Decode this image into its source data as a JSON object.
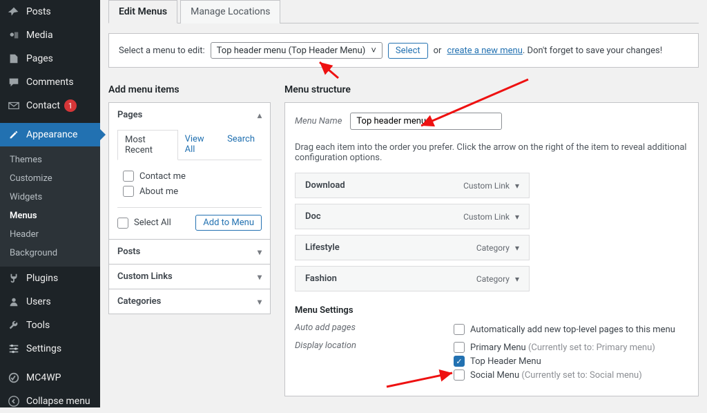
{
  "sidebar": {
    "items": [
      {
        "icon": "pin",
        "label": "Posts"
      },
      {
        "icon": "media",
        "label": "Media"
      },
      {
        "icon": "pages",
        "label": "Pages"
      },
      {
        "icon": "comments",
        "label": "Comments"
      },
      {
        "icon": "mail",
        "label": "Contact",
        "badge": "1"
      },
      {
        "icon": "brush",
        "label": "Appearance",
        "active": true
      },
      {
        "icon": "plug",
        "label": "Plugins"
      },
      {
        "icon": "users",
        "label": "Users"
      },
      {
        "icon": "wrench",
        "label": "Tools"
      },
      {
        "icon": "sliders",
        "label": "Settings"
      },
      {
        "icon": "mc4wp",
        "label": "MC4WP"
      },
      {
        "icon": "collapse",
        "label": "Collapse menu"
      }
    ],
    "sub": [
      "Themes",
      "Customize",
      "Widgets",
      "Menus",
      "Header",
      "Background"
    ],
    "sub_current": "Menus"
  },
  "tabs": {
    "edit": "Edit Menus",
    "manage": "Manage Locations"
  },
  "select_row": {
    "label": "Select a menu to edit:",
    "dropdown": "Top header menu (Top Header Menu)",
    "select_btn": "Select",
    "or": "or",
    "create_link": "create a new menu",
    "tail": ". Don't forget to save your changes!"
  },
  "left": {
    "title": "Add menu items",
    "panels": {
      "pages": {
        "title": "Pages",
        "tabs": [
          "Most Recent",
          "View All",
          "Search"
        ],
        "items": [
          "Contact me",
          "About me"
        ],
        "select_all": "Select All",
        "add_btn": "Add to Menu"
      },
      "posts": "Posts",
      "custom_links": "Custom Links",
      "categories": "Categories"
    }
  },
  "right": {
    "title": "Menu structure",
    "name_label": "Menu Name",
    "name_value": "Top header menu",
    "hint": "Drag each item into the order you prefer. Click the arrow on the right of the item to reveal additional configuration options.",
    "items": [
      {
        "name": "Download",
        "type": "Custom Link"
      },
      {
        "name": "Doc",
        "type": "Custom Link"
      },
      {
        "name": "Lifestyle",
        "type": "Category"
      },
      {
        "name": "Fashion",
        "type": "Category"
      }
    ],
    "settings": {
      "title": "Menu Settings",
      "auto_label": "Auto add pages",
      "auto_opt": "Automatically add new top-level pages to this menu",
      "disp_label": "Display location",
      "locations": [
        {
          "label": "Primary Menu",
          "note": "(Currently set to: Primary menu)",
          "checked": false
        },
        {
          "label": "Top Header Menu",
          "note": "",
          "checked": true
        },
        {
          "label": "Social Menu",
          "note": "(Currently set to: Social menu)",
          "checked": false
        }
      ]
    }
  }
}
